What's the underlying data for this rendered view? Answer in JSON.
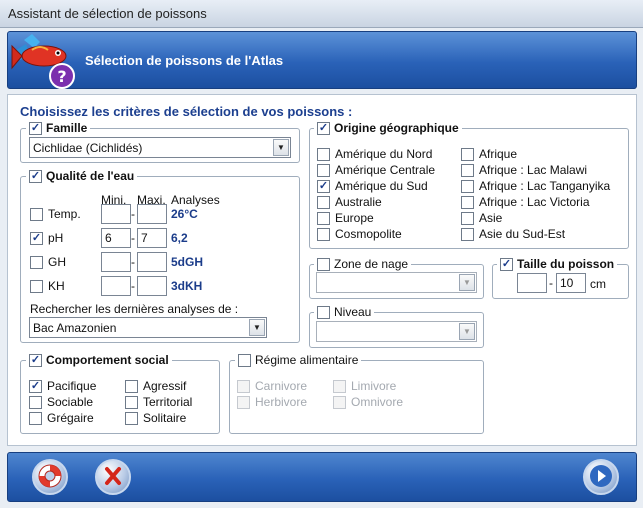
{
  "window": {
    "title": "Assistant de sélection de poissons"
  },
  "header": {
    "title": "Sélection de poissons de l'Atlas"
  },
  "main": {
    "heading": "Choisissez les critères de sélection de vos poissons :"
  },
  "famille": {
    "label": "Famille",
    "checked": true,
    "selected": "Cichlidae (Cichlidés)"
  },
  "eau": {
    "label": "Qualité de l'eau",
    "checked": true,
    "col_min": "Mini.",
    "col_max": "Maxi.",
    "col_analyses": "Analyses",
    "rows": [
      {
        "label": "Temp.",
        "checked": false,
        "min": "",
        "max": "",
        "analysis": "26°C"
      },
      {
        "label": "pH",
        "checked": true,
        "min": "6",
        "max": "7",
        "analysis": "6,2"
      },
      {
        "label": "GH",
        "checked": false,
        "min": "",
        "max": "",
        "analysis": "5dGH"
      },
      {
        "label": "KH",
        "checked": false,
        "min": "",
        "max": "",
        "analysis": "3dKH"
      }
    ],
    "search_label": "Rechercher les dernières analyses de :",
    "search_selected": "Bac Amazonien"
  },
  "origine": {
    "label": "Origine géographique",
    "checked": true,
    "col1": [
      {
        "label": "Amérique du Nord",
        "checked": false
      },
      {
        "label": "Amérique Centrale",
        "checked": false
      },
      {
        "label": "Amérique du Sud",
        "checked": true
      },
      {
        "label": "Australie",
        "checked": false
      },
      {
        "label": "Europe",
        "checked": false
      },
      {
        "label": "Cosmopolite",
        "checked": false
      }
    ],
    "col2": [
      {
        "label": "Afrique",
        "checked": false
      },
      {
        "label": "Afrique : Lac Malawi",
        "checked": false
      },
      {
        "label": "Afrique : Lac Tanganyika",
        "checked": false
      },
      {
        "label": "Afrique : Lac Victoria",
        "checked": false
      },
      {
        "label": "Asie",
        "checked": false
      },
      {
        "label": "Asie du Sud-Est",
        "checked": false
      }
    ]
  },
  "zone": {
    "label": "Zone de nage",
    "checked": false,
    "selected": ""
  },
  "niveau": {
    "label": "Niveau",
    "checked": false,
    "selected": ""
  },
  "taille": {
    "label": "Taille du poisson",
    "checked": true,
    "min": "",
    "max": "10",
    "unit": "cm"
  },
  "comportement": {
    "label": "Comportement social",
    "checked": true,
    "col1": [
      {
        "label": "Pacifique",
        "checked": true
      },
      {
        "label": "Sociable",
        "checked": false
      },
      {
        "label": "Grégaire",
        "checked": false
      }
    ],
    "col2": [
      {
        "label": "Agressif",
        "checked": false
      },
      {
        "label": "Territorial",
        "checked": false
      },
      {
        "label": "Solitaire",
        "checked": false
      }
    ]
  },
  "regime": {
    "label": "Régime alimentaire",
    "checked": false,
    "col1": [
      {
        "label": "Carnivore",
        "checked": false
      },
      {
        "label": "Herbivore",
        "checked": false
      }
    ],
    "col2": [
      {
        "label": "Limivore",
        "checked": false
      },
      {
        "label": "Omnivore",
        "checked": false
      }
    ]
  },
  "icons": {
    "logo": "fish-help-logo-icon",
    "help": "lifebuoy-icon",
    "cancel": "close-icon",
    "next": "arrow-right-icon"
  },
  "colors": {
    "accent": "#2a62b8",
    "heading": "#1c3f8f",
    "value": "#1b3c8a"
  }
}
